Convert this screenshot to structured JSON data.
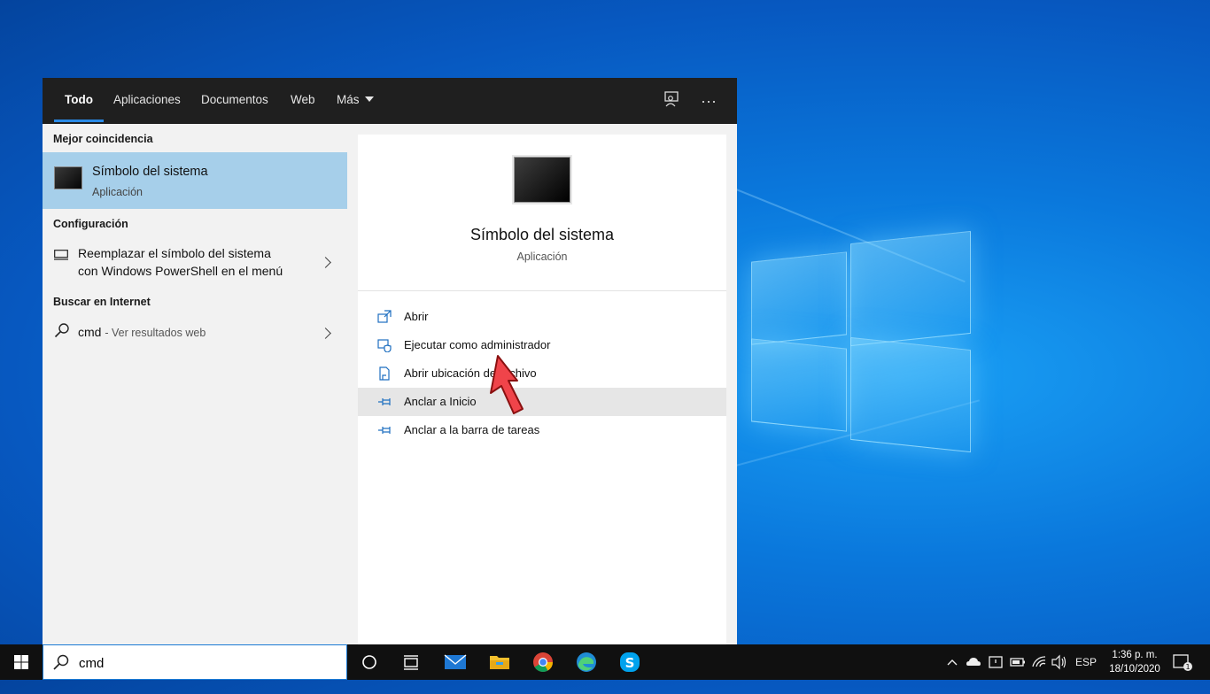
{
  "tabs": [
    "Todo",
    "Aplicaciones",
    "Documentos",
    "Web",
    "Más"
  ],
  "topbar_icons": [
    "feedback-icon",
    "more-icon"
  ],
  "left": {
    "best_match_header": "Mejor coincidencia",
    "best_match": {
      "title": "Símbolo del sistema",
      "subtitle": "Aplicación"
    },
    "settings_header": "Configuración",
    "settings_item": {
      "line1": "Reemplazar el símbolo del sistema",
      "line2": "con Windows PowerShell en el menú"
    },
    "web_header": "Buscar en Internet",
    "web_item": {
      "query": "cmd",
      "suffix": "- Ver resultados web"
    }
  },
  "right": {
    "title": "Símbolo del sistema",
    "subtitle": "Aplicación",
    "actions": [
      "Abrir",
      "Ejecutar como administrador",
      "Abrir ubicación de archivo",
      "Anclar a Inicio",
      "Anclar a la barra de tareas"
    ],
    "hovered_action": "Anclar a Inicio"
  },
  "taskbar": {
    "search_value": "cmd",
    "apps": [
      "cortana-icon",
      "task-view-icon",
      "mail-icon",
      "file-explorer-icon",
      "chrome-icon",
      "edge-icon",
      "skype-icon"
    ],
    "language": "ESP",
    "time": "1:36 p. m.",
    "date": "18/10/2020"
  },
  "colors": {
    "topbar": "#1f1f1f",
    "selected_row": "#a6cfea",
    "accent": "#2a8ae6",
    "action_icon": "#1e6fc0"
  }
}
